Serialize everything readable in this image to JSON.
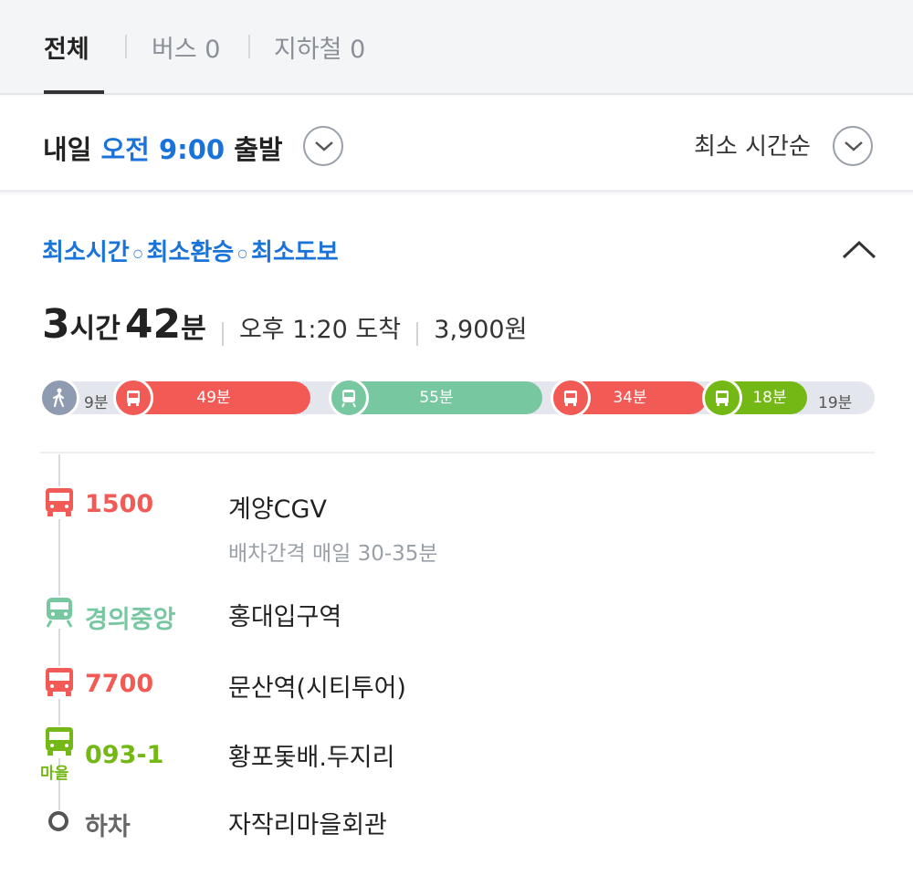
{
  "tabs": [
    {
      "label": "전체",
      "active": true
    },
    {
      "label": "버스 0",
      "active": false
    },
    {
      "label": "지하철 0",
      "active": false
    }
  ],
  "departure": {
    "day": "내일",
    "time": "오전 9:00",
    "suffix": "출발",
    "dropdown_icon": "chevron-down-icon"
  },
  "sort": {
    "label": "최소 시간순",
    "dropdown_icon": "chevron-down-icon"
  },
  "route": {
    "tags": [
      "최소시간",
      "최소환승",
      "최소도보"
    ],
    "collapse_icon": "chevron-up-icon",
    "duration_hours": "3",
    "duration_hours_unit": "시간",
    "duration_minutes": "42",
    "duration_minutes_unit": "분",
    "arrival": "오후 1:20 도착",
    "fare": "3,900원",
    "timeline": [
      {
        "kind": "walk",
        "label": "9분",
        "icon": "walk-icon",
        "color": "#8f9bb0"
      },
      {
        "kind": "bus",
        "label": "49분",
        "icon": "bus-icon",
        "color": "#f25a55"
      },
      {
        "kind": "train",
        "label": "55분",
        "icon": "train-icon",
        "color": "#77c7a1"
      },
      {
        "kind": "bus",
        "label": "34분",
        "icon": "bus-icon",
        "color": "#f25a55"
      },
      {
        "kind": "village-bus",
        "label": "18분",
        "icon": "bus-icon",
        "color": "#74b816"
      },
      {
        "kind": "walk",
        "label": "19분",
        "icon": "",
        "color": "#e3e6ec"
      }
    ],
    "steps": [
      {
        "line": "1500",
        "stop": "계양CGV",
        "sub": "배차간격 매일 30-35분",
        "icon": "bus-icon",
        "color": "#f25a55"
      },
      {
        "line": "경의중앙",
        "stop": "홍대입구역",
        "sub": "",
        "icon": "train-icon",
        "color": "#77c7a1"
      },
      {
        "line": "7700",
        "stop": "문산역(시티투어)",
        "sub": "",
        "icon": "bus-icon",
        "color": "#f25a55"
      },
      {
        "line": "093-1",
        "stop": "황포돛배.두지리",
        "sub": "",
        "icon": "bus-icon",
        "color": "#74b816",
        "badge": "마을"
      },
      {
        "line": "하차",
        "stop": "자작리마을회관",
        "sub": "",
        "icon": "stop-dot-icon",
        "color": "#555555"
      }
    ]
  }
}
